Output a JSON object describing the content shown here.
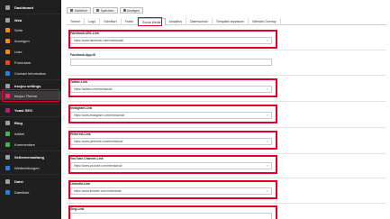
{
  "sidebar": {
    "items": [
      {
        "label": "Dashboard",
        "icon": "dashboard-icon",
        "color": "#9aa0a6"
      },
      {
        "label": "Web",
        "icon": "web-icon",
        "color": "#9aa0a6"
      },
      {
        "label": "Seite",
        "icon": "page-icon",
        "color": "#f08c1f"
      },
      {
        "label": "Anzeigen",
        "icon": "view-icon",
        "color": "#f08c1f"
      },
      {
        "label": "Liste",
        "icon": "list-icon",
        "color": "#f08c1f"
      },
      {
        "label": "Formulare",
        "icon": "forms-icon",
        "color": "#e04b2c"
      },
      {
        "label": "Contact Information",
        "icon": "contact-icon",
        "color": "#2f7fd8"
      },
      {
        "label": "bscjou settings",
        "icon": "settings-icon",
        "color": "#9aa0a6"
      },
      {
        "label": "bscjou Theme",
        "icon": "theme-icon",
        "color": "#d6336c"
      },
      {
        "label": "Yoast SEO",
        "icon": "yoast-icon",
        "color": "#a4286a"
      },
      {
        "label": "Blog",
        "icon": "blog-icon",
        "color": "#9aa0a6"
      },
      {
        "label": "Artikel",
        "icon": "article-icon",
        "color": "#4caf50"
      },
      {
        "label": "Kommentare",
        "icon": "comments-icon",
        "color": "#4caf50"
      },
      {
        "label": "Seitenverwaltung",
        "icon": "site-management-icon",
        "color": "#9aa0a6"
      },
      {
        "label": "Weiterleitungen",
        "icon": "redirect-icon",
        "color": "#2f7fd8"
      },
      {
        "label": "Datei",
        "icon": "file-icon",
        "color": "#9aa0a6"
      },
      {
        "label": "Dateiliste",
        "icon": "filelist-icon",
        "color": "#2f7fd8"
      }
    ]
  },
  "toolbar": {
    "buttons": [
      {
        "label": "Schließen"
      },
      {
        "label": "Speichern"
      },
      {
        "label": "Anzeigen"
      }
    ]
  },
  "tabs": [
    {
      "label": "Theme"
    },
    {
      "label": "Logo"
    },
    {
      "label": "Schriftart"
    },
    {
      "label": "Farbe"
    },
    {
      "label": "Social Media"
    },
    {
      "label": "Analytics"
    },
    {
      "label": "Datenschutz"
    },
    {
      "label": "Template anpassen"
    },
    {
      "label": "Website-Overlay"
    }
  ],
  "fields": [
    {
      "label": "Facebook-URL-Link",
      "value": "https://www.facebook.com/meinkanal/"
    },
    {
      "label": "Facebook-App-ID",
      "value": ""
    },
    {
      "label": "Twitter-Link",
      "value": "https://twitter.com/meinkanal/"
    },
    {
      "label": "Instagram-Link",
      "value": "https://www.instagram.com/meinkanal/"
    },
    {
      "label": "Pinterest-Link",
      "value": "https://www.pinterest.com/meinkanal/"
    },
    {
      "label": "YouTube-Channel-Link",
      "value": "https://www.youtube.com/meinkanal/"
    },
    {
      "label": "LinkedIn-Link",
      "value": "https://www.linkedin.com/meinkanal/"
    },
    {
      "label": "Xing-Link",
      "value": ""
    }
  ],
  "colors": {
    "highlight": "#e0002a",
    "sidebar_bg": "#1f1f1f"
  }
}
